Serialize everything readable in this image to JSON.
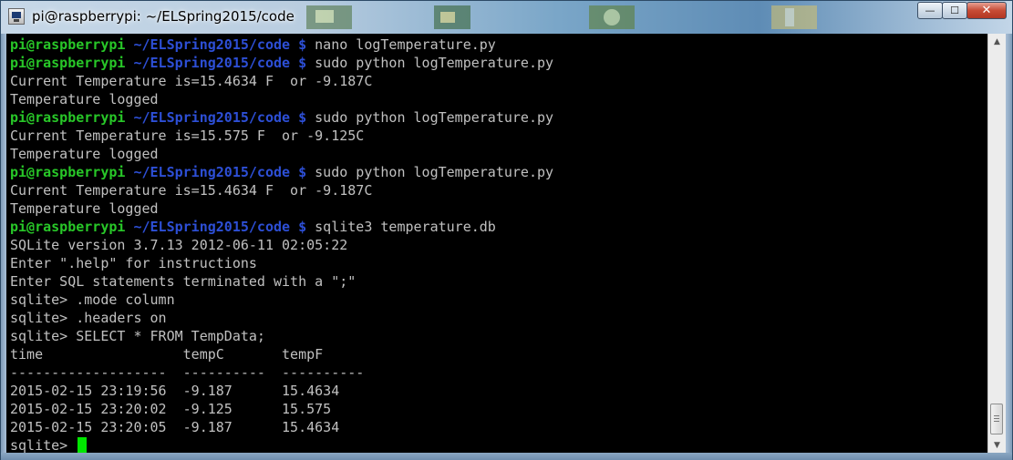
{
  "window": {
    "title": "pi@raspberrypi: ~/ELSpring2015/code",
    "controls": {
      "minimize": "—",
      "maximize": "☐",
      "close": "✕"
    }
  },
  "prompt": {
    "user": "pi@raspberrypi",
    "path": "~/ELSpring2015/code",
    "symbol": "$"
  },
  "terminal": {
    "lines": [
      {
        "type": "prompt",
        "cmd": "nano logTemperature.py"
      },
      {
        "type": "prompt",
        "cmd": "sudo python logTemperature.py"
      },
      {
        "type": "output",
        "text": "Current Temperature is=15.4634 F  or -9.187C"
      },
      {
        "type": "output",
        "text": "Temperature logged"
      },
      {
        "type": "prompt",
        "cmd": "sudo python logTemperature.py"
      },
      {
        "type": "output",
        "text": "Current Temperature is=15.575 F  or -9.125C"
      },
      {
        "type": "output",
        "text": "Temperature logged"
      },
      {
        "type": "prompt",
        "cmd": "sudo python logTemperature.py"
      },
      {
        "type": "output",
        "text": "Current Temperature is=15.4634 F  or -9.187C"
      },
      {
        "type": "output",
        "text": "Temperature logged"
      },
      {
        "type": "prompt",
        "cmd": "sqlite3 temperature.db"
      },
      {
        "type": "output",
        "text": "SQLite version 3.7.13 2012-06-11 02:05:22"
      },
      {
        "type": "output",
        "text": "Enter \".help\" for instructions"
      },
      {
        "type": "output",
        "text": "Enter SQL statements terminated with a \";\""
      },
      {
        "type": "output",
        "text": "sqlite> .mode column"
      },
      {
        "type": "output",
        "text": "sqlite> .headers on"
      },
      {
        "type": "output",
        "text": "sqlite> SELECT * FROM TempData;"
      },
      {
        "type": "output",
        "text": "time                 tempC       tempF"
      },
      {
        "type": "output",
        "text": "-------------------  ----------  ----------"
      },
      {
        "type": "output",
        "text": "2015-02-15 23:19:56  -9.187      15.4634"
      },
      {
        "type": "output",
        "text": "2015-02-15 23:20:02  -9.125      15.575"
      },
      {
        "type": "output",
        "text": "2015-02-15 23:20:05  -9.187      15.4634"
      },
      {
        "type": "cursor",
        "text": "sqlite> "
      }
    ]
  },
  "query_result": {
    "columns": [
      "time",
      "tempC",
      "tempF"
    ],
    "rows": [
      [
        "2015-02-15 23:19:56",
        "-9.187",
        "15.4634"
      ],
      [
        "2015-02-15 23:20:02",
        "-9.125",
        "15.575"
      ],
      [
        "2015-02-15 23:20:05",
        "-9.187",
        "15.4634"
      ]
    ]
  },
  "scrollbar": {
    "position_fraction": 0.98
  },
  "colors": {
    "prompt_user": "#28c728",
    "prompt_path": "#2d4fd6",
    "text": "#c0c0c0",
    "cursor": "#00e600",
    "background": "#000000"
  }
}
